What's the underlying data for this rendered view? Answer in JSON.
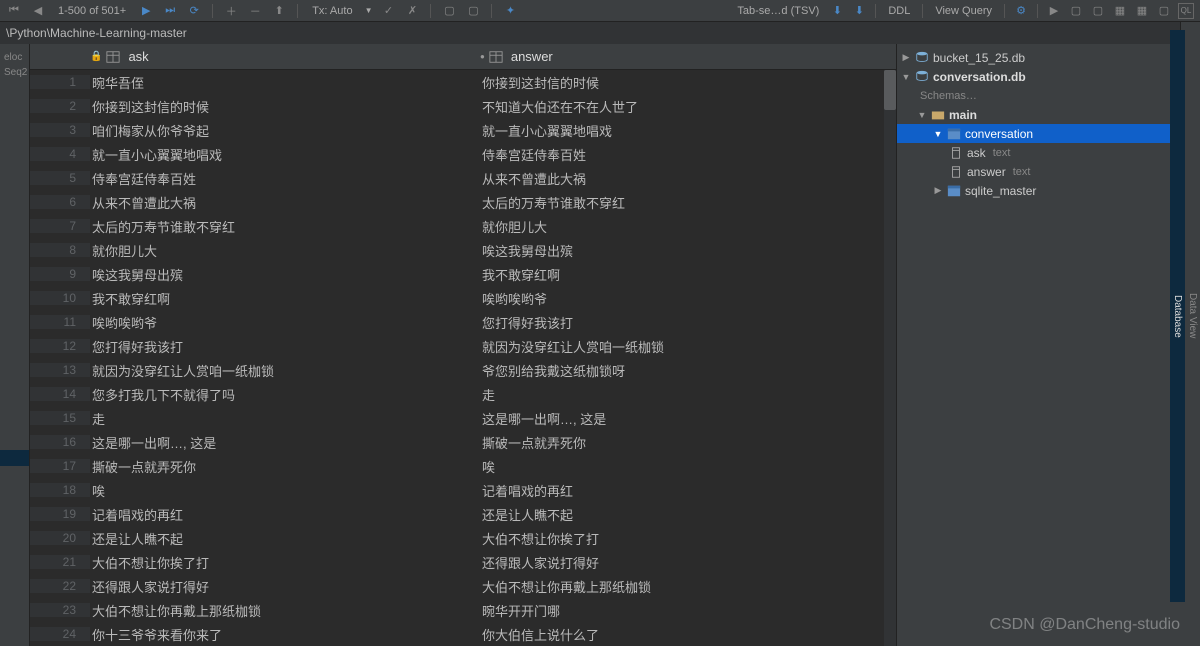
{
  "toolbar": {
    "pager": "1-500 of 501+",
    "tx": "Tx: Auto",
    "tab_format": "Tab-se…d (TSV)",
    "ddl": "DDL",
    "view_query": "View Query"
  },
  "path": "\\Python\\Machine-Learning-master",
  "left_items": [
    "eloc",
    "Seq2"
  ],
  "columns": {
    "ask": "ask",
    "answer": "answer"
  },
  "rows": [
    {
      "n": 1,
      "ask": "晼华吾侄",
      "answer": "你接到这封信的时候"
    },
    {
      "n": 2,
      "ask": "你接到这封信的时候",
      "answer": "不知道大伯还在不在人世了"
    },
    {
      "n": 3,
      "ask": "咱们梅家从你爷爷起",
      "answer": "就一直小心翼翼地唱戏"
    },
    {
      "n": 4,
      "ask": "就一直小心翼翼地唱戏",
      "answer": "侍奉宫廷侍奉百姓"
    },
    {
      "n": 5,
      "ask": "侍奉宫廷侍奉百姓",
      "answer": "从来不曾遭此大祸"
    },
    {
      "n": 6,
      "ask": "从来不曾遭此大祸",
      "answer": "太后的万寿节谁敢不穿红"
    },
    {
      "n": 7,
      "ask": "太后的万寿节谁敢不穿红",
      "answer": "就你胆儿大"
    },
    {
      "n": 8,
      "ask": "就你胆儿大",
      "answer": "唉这我舅母出殡"
    },
    {
      "n": 9,
      "ask": "唉这我舅母出殡",
      "answer": "我不敢穿红啊"
    },
    {
      "n": 10,
      "ask": "我不敢穿红啊",
      "answer": "唉哟唉哟爷"
    },
    {
      "n": 11,
      "ask": "唉哟唉哟爷",
      "answer": "您打得好我该打"
    },
    {
      "n": 12,
      "ask": "您打得好我该打",
      "answer": "就因为没穿红让人赏咱一纸枷锁"
    },
    {
      "n": 13,
      "ask": "就因为没穿红让人赏咱一纸枷锁",
      "answer": "爷您别给我戴这纸枷锁呀"
    },
    {
      "n": 14,
      "ask": "您多打我几下不就得了吗",
      "answer": "走"
    },
    {
      "n": 15,
      "ask": "走",
      "answer": "这是哪一出啊…, 这是"
    },
    {
      "n": 16,
      "ask": "这是哪一出啊…, 这是",
      "answer": "撕破一点就弄死你"
    },
    {
      "n": 17,
      "ask": "撕破一点就弄死你",
      "answer": "唉"
    },
    {
      "n": 18,
      "ask": "唉",
      "answer": "记着唱戏的再红"
    },
    {
      "n": 19,
      "ask": "记着唱戏的再红",
      "answer": "还是让人瞧不起"
    },
    {
      "n": 20,
      "ask": "还是让人瞧不起",
      "answer": "大伯不想让你挨了打"
    },
    {
      "n": 21,
      "ask": "大伯不想让你挨了打",
      "answer": "还得跟人家说打得好"
    },
    {
      "n": 22,
      "ask": "还得跟人家说打得好",
      "answer": "大伯不想让你再戴上那纸枷锁"
    },
    {
      "n": 23,
      "ask": "大伯不想让你再戴上那纸枷锁",
      "answer": "晼华开开门哪"
    },
    {
      "n": 24,
      "ask": "你十三爷爷来看你来了",
      "answer": "你大伯信上说什么了"
    }
  ],
  "tree": {
    "db1": "bucket_15_25.db",
    "db2": "conversation.db",
    "schemas": "Schemas…",
    "main": "main",
    "table": "conversation",
    "col_ask": "ask",
    "col_answer": "answer",
    "col_type": "text",
    "sqlite_master": "sqlite_master"
  },
  "right_tabs": {
    "data": "Data View",
    "database": "Database"
  },
  "watermark": "CSDN @DanCheng-studio"
}
